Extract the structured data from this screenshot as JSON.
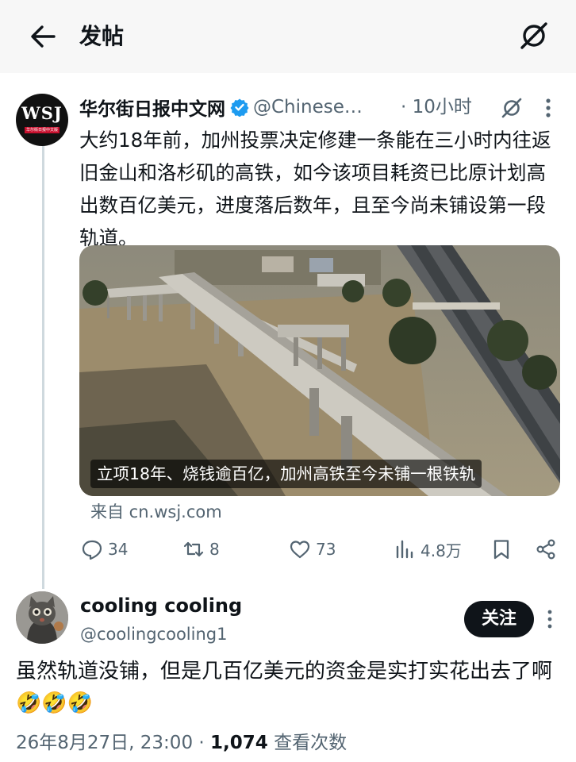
{
  "header": {
    "title": "发帖"
  },
  "tweet": {
    "author_name": "华尔街日报中文网",
    "handle": "@Chinese…",
    "time": "· 10小时",
    "avatar_text": "WSJ",
    "avatar_subtext": "华尔街日报中文版",
    "text": "大约18年前，加州投票决定修建一条能在三小时内往返旧金山和洛杉矶的高铁，如今该项目耗资已比原计划高出数百亿美元，进度落后数年，且至今尚未铺设第一段轨道。",
    "media_caption": "立项18年、烧钱逾百亿，加州高铁至今未铺一根铁轨",
    "source": "来自 cn.wsj.com",
    "stats": {
      "replies": "34",
      "retweets": "8",
      "likes": "73",
      "views": "4.8万"
    }
  },
  "reply": {
    "name": "cooling cooling",
    "handle": "@coolingcooling1",
    "follow_label": "关注",
    "text": "虽然轨道没铺，但是几百亿美元的资金是实打实花出去了啊🤣🤣🤣",
    "date": "26年8月27日, 23:00 · ",
    "views_count": "1,074",
    "views_label": " 查看次数"
  },
  "colors": {
    "accent": "#1d9bf0",
    "text": "#0f1419",
    "muted": "#536471",
    "wsj_red": "#c8102e"
  },
  "icons": [
    "back-arrow-icon",
    "grok-icon",
    "verified-icon",
    "more-icon",
    "reply-icon",
    "retweet-icon",
    "like-icon",
    "views-icon",
    "bookmark-icon",
    "share-icon"
  ]
}
